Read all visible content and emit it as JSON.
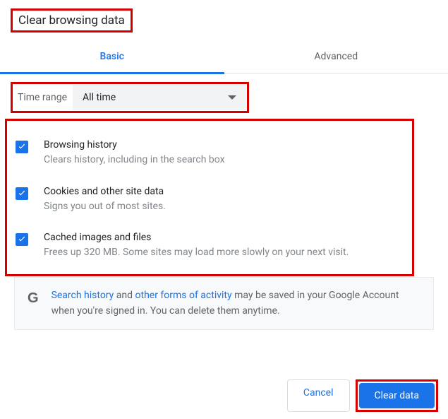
{
  "title": "Clear browsing data",
  "tabs": {
    "basic": "Basic",
    "advanced": "Advanced"
  },
  "time_range": {
    "label": "Time range",
    "value": "All time"
  },
  "options": [
    {
      "title": "Browsing history",
      "desc": "Clears history, including in the search box",
      "checked": true
    },
    {
      "title": "Cookies and other site data",
      "desc": "Signs you out of most sites.",
      "checked": true
    },
    {
      "title": "Cached images and files",
      "desc": "Frees up 320 MB. Some sites may load more slowly on your next visit.",
      "checked": true
    }
  ],
  "info": {
    "link1": "Search history",
    "mid1": " and ",
    "link2": "other forms of activity",
    "rest": " may be saved in your Google Account when you're signed in. You can delete them anytime."
  },
  "buttons": {
    "cancel": "Cancel",
    "clear": "Clear data"
  }
}
